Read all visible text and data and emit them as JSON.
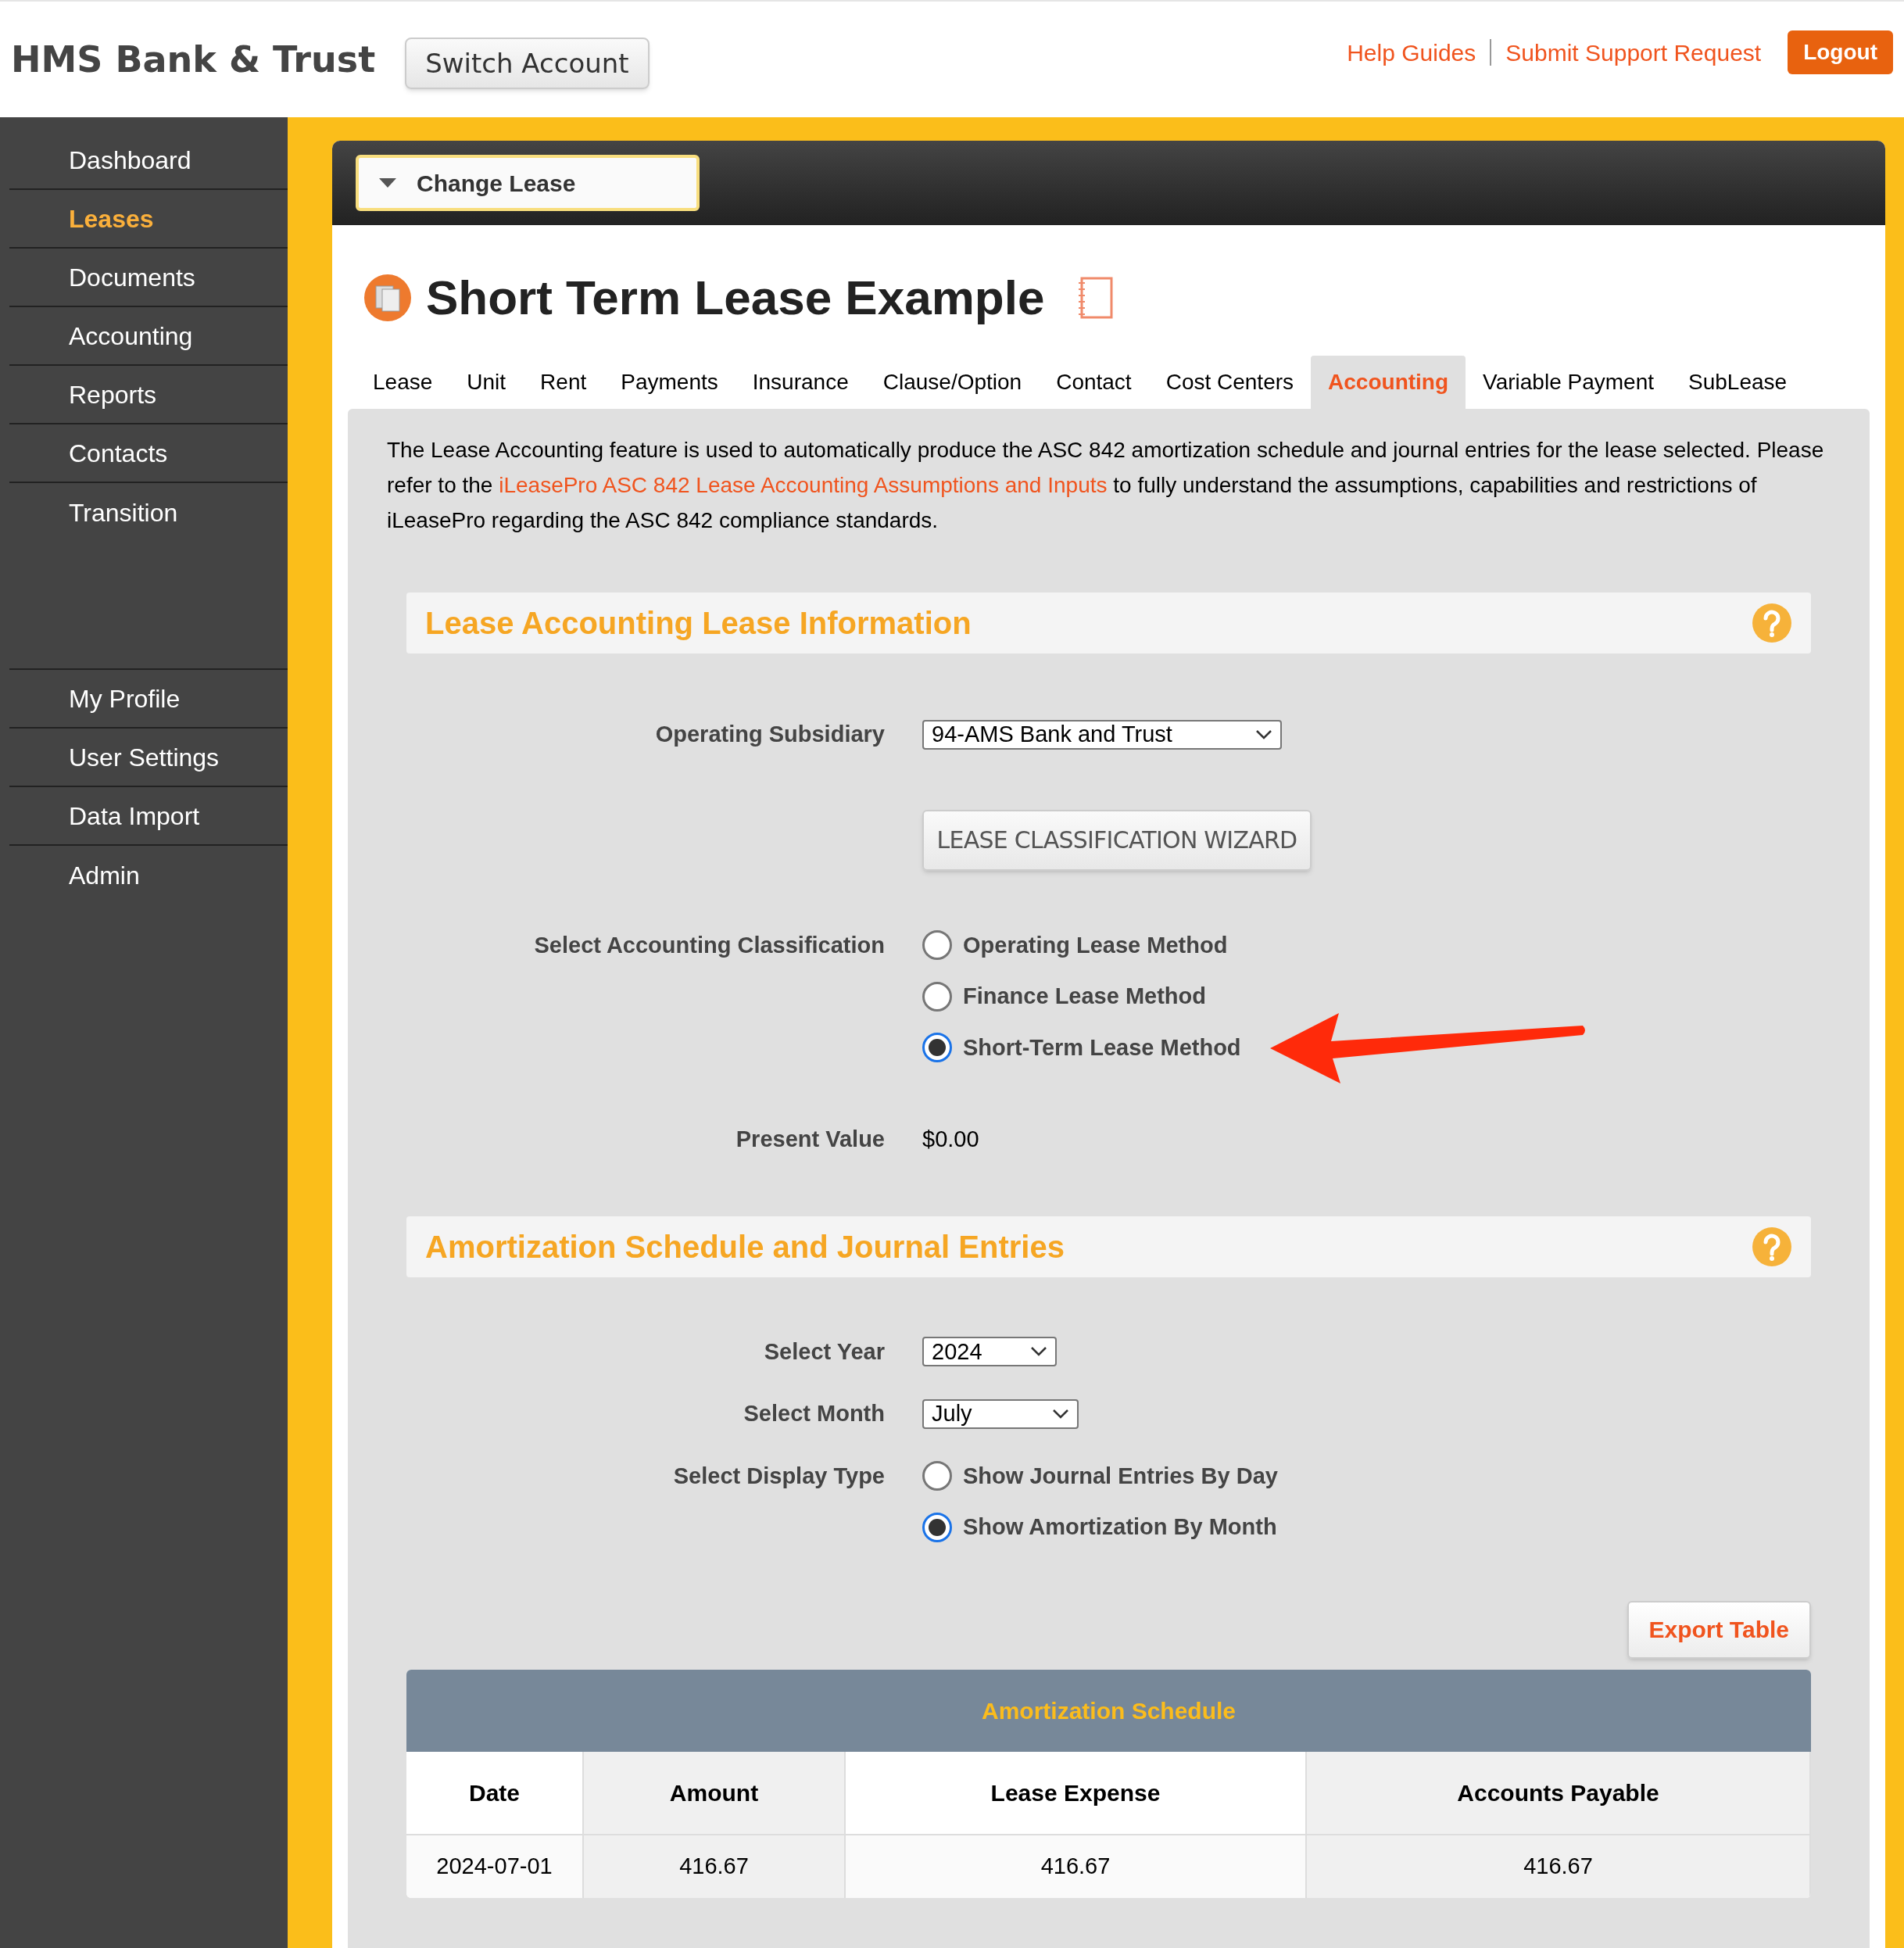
{
  "header": {
    "brand": "HMS Bank & Trust",
    "switch_button": "Switch Account",
    "links": [
      "Help Guides",
      "Submit Support Request"
    ],
    "logout": "Logout"
  },
  "sidebar": {
    "groups": [
      [
        {
          "label": "Dashboard",
          "selected": false
        },
        {
          "label": "Leases",
          "selected": true
        },
        {
          "label": "Documents",
          "selected": false
        },
        {
          "label": "Accounting",
          "selected": false
        },
        {
          "label": "Reports",
          "selected": false
        },
        {
          "label": "Contacts",
          "selected": false
        },
        {
          "label": "Transition",
          "selected": false
        }
      ],
      [
        {
          "label": "My Profile",
          "selected": false
        },
        {
          "label": "User Settings",
          "selected": false
        },
        {
          "label": "Data Import",
          "selected": false
        },
        {
          "label": "Admin",
          "selected": false
        }
      ]
    ]
  },
  "change_lease": "Change Lease",
  "title": "Short Term Lease Example",
  "tabs": [
    {
      "label": "Lease",
      "selected": false
    },
    {
      "label": "Unit",
      "selected": false
    },
    {
      "label": "Rent",
      "selected": false
    },
    {
      "label": "Payments",
      "selected": false
    },
    {
      "label": "Insurance",
      "selected": false
    },
    {
      "label": "Clause/Option",
      "selected": false
    },
    {
      "label": "Contact",
      "selected": false
    },
    {
      "label": "Cost Centers",
      "selected": false
    },
    {
      "label": "Accounting",
      "selected": true
    },
    {
      "label": "Variable Payment",
      "selected": false
    },
    {
      "label": "SubLease",
      "selected": false
    }
  ],
  "intro": {
    "before": "The Lease Accounting feature is used to automatically produce the ASC 842 amortization schedule and journal entries for the lease selected. Please refer to the ",
    "link": "iLeasePro ASC 842 Lease Accounting Assumptions and Inputs",
    "after": " to fully understand the assumptions, capabilities and restrictions of iLeasePro regarding the ASC 842 compliance standards."
  },
  "lease_info": {
    "heading": "Lease Accounting Lease Information",
    "subsidiary": {
      "label": "Operating Subsidiary",
      "value": "94-AMS Bank and Trust"
    },
    "wizard_button": "LEASE CLASSIFICATION WIZARD",
    "classification": {
      "label": "Select Accounting Classification",
      "options": [
        {
          "label": "Operating Lease Method",
          "selected": false
        },
        {
          "label": "Finance Lease Method",
          "selected": false
        },
        {
          "label": "Short-Term Lease Method",
          "selected": true
        }
      ]
    },
    "present_value": {
      "label": "Present Value",
      "value": "$0.00"
    }
  },
  "amortization": {
    "heading": "Amortization Schedule and Journal Entries",
    "year": {
      "label": "Select Year",
      "value": "2024"
    },
    "month": {
      "label": "Select Month",
      "value": "July"
    },
    "display_type": {
      "label": "Select Display Type",
      "options": [
        {
          "label": "Show Journal Entries By Day",
          "selected": false
        },
        {
          "label": "Show Amortization By Month",
          "selected": true
        }
      ]
    },
    "export_button": "Export Table",
    "table": {
      "title": "Amortization Schedule",
      "columns": [
        "Date",
        "Amount",
        "Lease Expense",
        "Accounts Payable"
      ],
      "rows": [
        [
          "2024-07-01",
          "416.67",
          "416.67",
          "416.67"
        ]
      ]
    }
  }
}
